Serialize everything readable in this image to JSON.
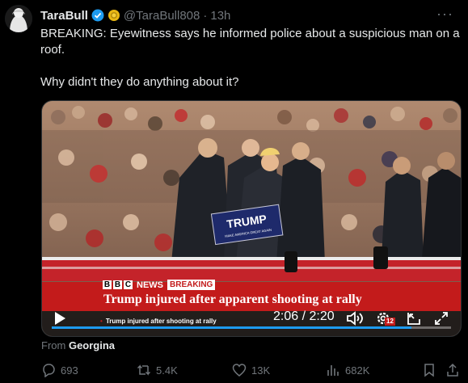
{
  "tweet": {
    "author_name": "TaraBull",
    "handle": "@TaraBull808",
    "separator": "·",
    "time": "13h",
    "more_label": "···",
    "text": "BREAKING: Eyewitness says he informed police about a suspicious man on a roof.\n\nWhy didn't they do anything about it?"
  },
  "video": {
    "bbc_letters": [
      "B",
      "B",
      "C"
    ],
    "news_label": "NEWS",
    "breaking_label": "BREAKING",
    "headline": "Trump injured after apparent shooting at rally",
    "ticker": "Trump injured after shooting at rally",
    "sign_main": "TRUMP",
    "sign_small": "MAKE AMERICA GREAT AGAIN",
    "time_display": "2:06 / 2:20",
    "progress": 0.9,
    "quality_badge": "12"
  },
  "attribution": {
    "from_label": "From",
    "from_name": "Georgina"
  },
  "actions": {
    "replies": "693",
    "reposts": "5.4K",
    "likes": "13K",
    "views": "682K"
  },
  "colors": {
    "accent": "#1d9bf0",
    "verified": "#1d9bf0",
    "gold_badge": "#e8b613",
    "bbc_red": "#c31b1b"
  },
  "icons": [
    "verified-badge-icon",
    "gold-badge-icon",
    "more-icon",
    "play-icon",
    "volume-icon",
    "settings-icon",
    "pip-icon",
    "fullscreen-icon",
    "reply-icon",
    "repost-icon",
    "like-icon",
    "views-icon",
    "bookmark-icon",
    "share-icon"
  ]
}
